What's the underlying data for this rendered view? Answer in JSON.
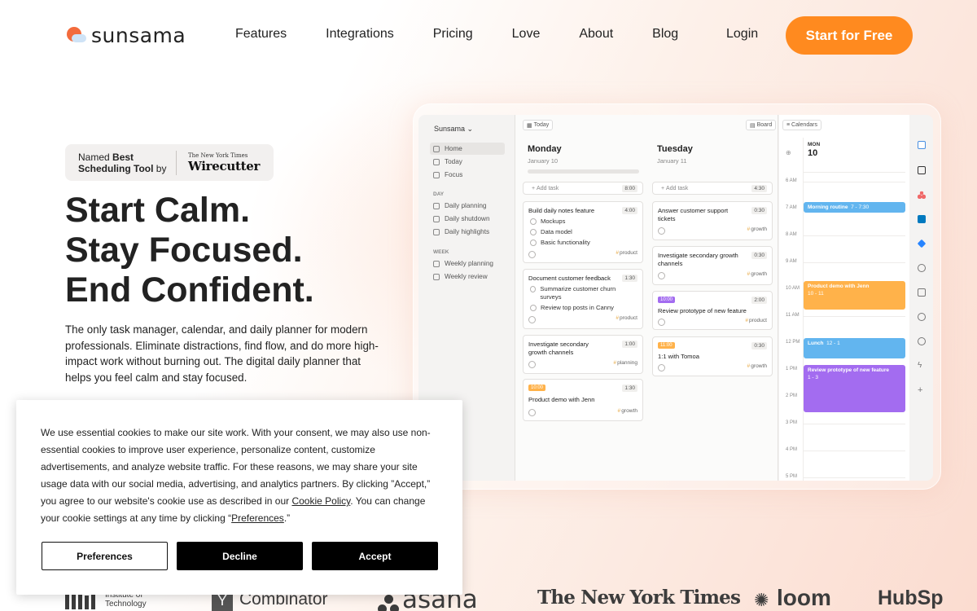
{
  "nav": {
    "logo_text": "sunsama",
    "links": [
      "Features",
      "Integrations",
      "Pricing",
      "Love",
      "About",
      "Blog"
    ],
    "login": "Login",
    "cta": "Start for Free"
  },
  "hero": {
    "award_prefix": "Named",
    "award_bold": "Best Scheduling Tool",
    "award_suffix": "by",
    "award_brand_small": "The New York Times",
    "award_brand_big": "Wirecutter",
    "headline": [
      "Start Calm.",
      "Stay Focused.",
      "End Confident."
    ],
    "subtext": "The only task manager, calendar, and daily planner for modern professionals. Eliminate distractions, find flow, and do more high-impact work without burning out. The digital daily planner that helps you feel calm and stay focused."
  },
  "app": {
    "workspace": "Sunsama",
    "sidebar_top": [
      "Home",
      "Today",
      "Focus"
    ],
    "section_day": "DAY",
    "sidebar_day": [
      "Daily planning",
      "Daily shutdown",
      "Daily highlights"
    ],
    "section_week": "WEEK",
    "sidebar_week": [
      "Weekly planning",
      "Weekly review"
    ],
    "today_chip": "Today",
    "board_chip": "Board",
    "calendars_chip": "Calendars",
    "add_task": "Add task",
    "monday": {
      "title": "Monday",
      "date": "January 10",
      "add_dur": "8:00",
      "tasks": [
        {
          "title": "Build daily notes feature",
          "dur": "4:00",
          "subs": [
            "Mockups",
            "Data model",
            "Basic functionality"
          ],
          "tag": "product"
        },
        {
          "title": "Document customer feedback",
          "dur": "1:30",
          "subs": [
            "Summarize customer churn surveys",
            "Review top posts in Canny"
          ],
          "tag": "product"
        },
        {
          "title": "Investigate secondary growth channels",
          "dur": "1:00",
          "tag": "planning"
        },
        {
          "badge": "10:00",
          "title": "Product demo with Jenn",
          "dur": "1:30",
          "tag": "growth"
        }
      ]
    },
    "tuesday": {
      "title": "Tuesday",
      "date": "January 11",
      "add_dur": "4:30",
      "tasks": [
        {
          "title": "Answer customer support tickets",
          "dur": "0:30",
          "tag": "growth"
        },
        {
          "title": "Investigate secondary growth channels",
          "dur": "0:30",
          "tag": "growth"
        },
        {
          "badge": "10:00",
          "title": "Review prototype of new feature",
          "dur": "2:00",
          "tag": "product"
        },
        {
          "badge": "11:00",
          "title": "1:1 with Tomoa",
          "dur": "0:30",
          "tag": "growth"
        }
      ]
    },
    "calendar": {
      "day_label": "MON",
      "day_num": "10",
      "hours": [
        "6 AM",
        "7 AM",
        "8 AM",
        "9 AM",
        "10 AM",
        "11 AM",
        "12 PM",
        "1 PM",
        "2 PM",
        "3 PM",
        "4 PM",
        "5 PM"
      ],
      "events": [
        {
          "title": "Morning routine",
          "time": "7 - 7:30"
        },
        {
          "title": "Product demo with Jenn",
          "time": "10 - 11"
        },
        {
          "title": "Lunch",
          "time": "12 - 1"
        },
        {
          "title": "Review prototype of new feature",
          "time": "1 - 3"
        }
      ]
    }
  },
  "cookie": {
    "text_1": "We use essential cookies to make our site work. With your consent, we may also use non-essential cookies to improve user experience, personalize content, customize advertisements, and analyze website traffic. For these reasons, we may share your site usage data with our social media, advertising, and analytics partners. By clicking ”Accept,” you agree to our website's cookie use as described in our ",
    "link_policy": "Cookie Policy",
    "text_2": ". You can change your cookie settings at any time by clicking “",
    "link_prefs": "Preferences",
    "text_3": ".”",
    "btn_preferences": "Preferences",
    "btn_decline": "Decline",
    "btn_accept": "Accept"
  },
  "logos": {
    "mit_line1": "Institute of",
    "mit_line2": "Technology",
    "yc": "Combinator",
    "yc_mark": "Y",
    "asana": "asana",
    "nyt": "The New York Times",
    "loom": "loom",
    "hubspot": "HubSp"
  },
  "colors": {
    "cta": "#ff8a1f",
    "brand_sun": "#f36b3c",
    "event_blue": "#62b5ef",
    "event_orange": "#ffb24a",
    "event_purple": "#a36cf0"
  }
}
